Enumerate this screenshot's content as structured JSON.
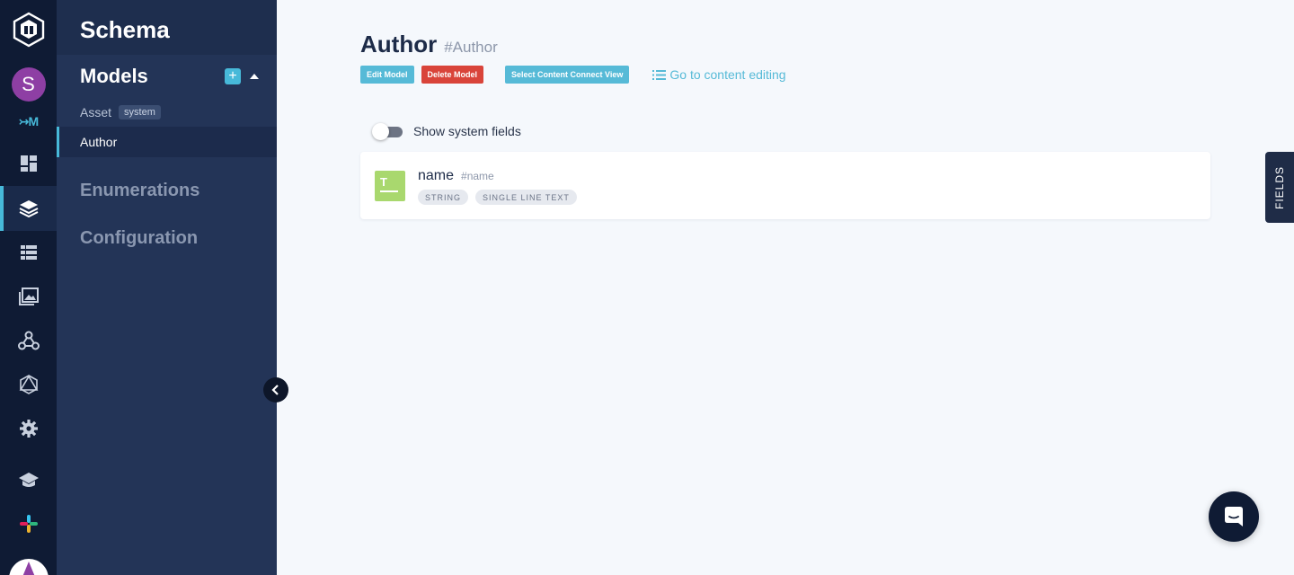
{
  "rail": {
    "avatar_initial": "S",
    "env_label": "↣M",
    "icons": [
      "graphcms-logo-icon",
      "dashboard-icon",
      "schema-layers-icon",
      "content-table-icon",
      "assets-image-icon",
      "webhooks-icon",
      "api-playground-icon",
      "settings-gear-icon",
      "learn-icon",
      "integrations-icon"
    ]
  },
  "sidebar": {
    "title": "Schema",
    "models_heading": "Models",
    "add_label": "+",
    "models": [
      {
        "label": "Asset",
        "tag": "system"
      },
      {
        "label": "Author"
      }
    ],
    "sections": [
      "Enumerations",
      "Configuration"
    ]
  },
  "main": {
    "title": "Author",
    "api_id": "#Author",
    "actions": {
      "edit": "Edit Model",
      "delete": "Delete Model",
      "select_view": "Select Content Connect View",
      "goto": "Go to content editing"
    },
    "toggle_label": "Show system fields",
    "fields": [
      {
        "icon_letter": "T",
        "name": "name",
        "api_id": "#name",
        "tags": [
          "STRING",
          "SINGLE LINE TEXT"
        ]
      }
    ]
  },
  "fields_tab": "FIELDS",
  "colors": {
    "accent": "#47b9d9",
    "danger": "#d9443a",
    "rail": "#0f1b34",
    "sidebar": "#233457"
  }
}
